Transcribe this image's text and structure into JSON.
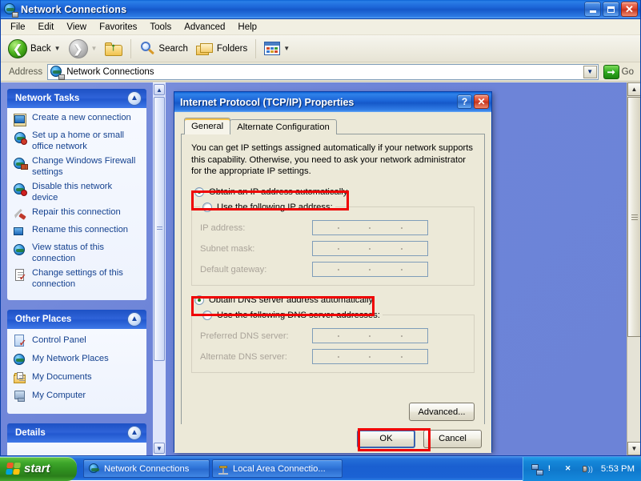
{
  "window": {
    "title": "Network Connections",
    "icon": "network-globe-icon",
    "buttons": {
      "minimize": "_",
      "maximize": "❐",
      "close": "✕"
    }
  },
  "menu": {
    "items": [
      "File",
      "Edit",
      "View",
      "Favorites",
      "Tools",
      "Advanced",
      "Help"
    ]
  },
  "toolbar": {
    "back_label": "Back",
    "forward_label": "",
    "up_label": "",
    "search_label": "Search",
    "folders_label": "Folders",
    "views_label": ""
  },
  "address": {
    "label": "Address",
    "value": "Network Connections",
    "go_label": "Go"
  },
  "sidebar": {
    "panels": [
      {
        "title": "Network Tasks",
        "items": [
          {
            "label": "Create a new connection",
            "icon": "new-connection-icon"
          },
          {
            "label": "Set up a home or small office network",
            "icon": "home-network-icon"
          },
          {
            "label": "Change Windows Firewall settings",
            "icon": "firewall-icon"
          },
          {
            "label": "Disable this network device",
            "icon": "disable-device-icon"
          },
          {
            "label": "Repair this connection",
            "icon": "repair-icon"
          },
          {
            "label": "Rename this connection",
            "icon": "rename-icon"
          },
          {
            "label": "View status of this connection",
            "icon": "view-status-icon"
          },
          {
            "label": "Change settings of this connection",
            "icon": "change-settings-icon"
          }
        ]
      },
      {
        "title": "Other Places",
        "items": [
          {
            "label": "Control Panel",
            "icon": "control-panel-icon"
          },
          {
            "label": "My Network Places",
            "icon": "network-places-icon"
          },
          {
            "label": "My Documents",
            "icon": "my-documents-icon"
          },
          {
            "label": "My Computer",
            "icon": "my-computer-icon"
          }
        ]
      },
      {
        "title": "Details",
        "items": []
      }
    ]
  },
  "dialog": {
    "title": "Internet Protocol (TCP/IP) Properties",
    "help_glyph": "?",
    "close_glyph": "✕",
    "tabs": [
      {
        "label": "General",
        "active": true
      },
      {
        "label": "Alternate Configuration",
        "active": false
      }
    ],
    "intro": "You can get IP settings assigned automatically if your network supports this capability. Otherwise, you need to ask your network administrator for the appropriate IP settings.",
    "ip_section": {
      "auto_label": "Obtain an IP address automatically",
      "auto_selected": true,
      "manual_label": "Use the following IP address:",
      "manual_selected": false,
      "fields": [
        {
          "label": "IP address:",
          "value": ""
        },
        {
          "label": "Subnet mask:",
          "value": ""
        },
        {
          "label": "Default gateway:",
          "value": ""
        }
      ]
    },
    "dns_section": {
      "auto_label": "Obtain DNS server address automatically",
      "auto_selected": true,
      "manual_label": "Use the following DNS server addresses:",
      "manual_selected": false,
      "fields": [
        {
          "label": "Preferred DNS server:",
          "value": ""
        },
        {
          "label": "Alternate DNS server:",
          "value": ""
        }
      ]
    },
    "advanced_label": "Advanced...",
    "ok_label": "OK",
    "cancel_label": "Cancel"
  },
  "highlights": {
    "color": "#ef0000",
    "targets": [
      "obtain-ip-automatically-radio",
      "obtain-dns-automatically-radio",
      "ok-button"
    ]
  },
  "taskbar": {
    "start_label": "start",
    "tasks": [
      {
        "label": "Network Connections",
        "icon": "network-globe-icon",
        "active": true
      },
      {
        "label": "Local Area Connectio...",
        "icon": "lan-connection-icon",
        "active": false
      }
    ],
    "tray": {
      "icons": [
        "network-status-icon",
        "warning-shield-icon",
        "alert-shield-icon",
        "volume-icon"
      ],
      "clock": "5:53 PM"
    }
  }
}
